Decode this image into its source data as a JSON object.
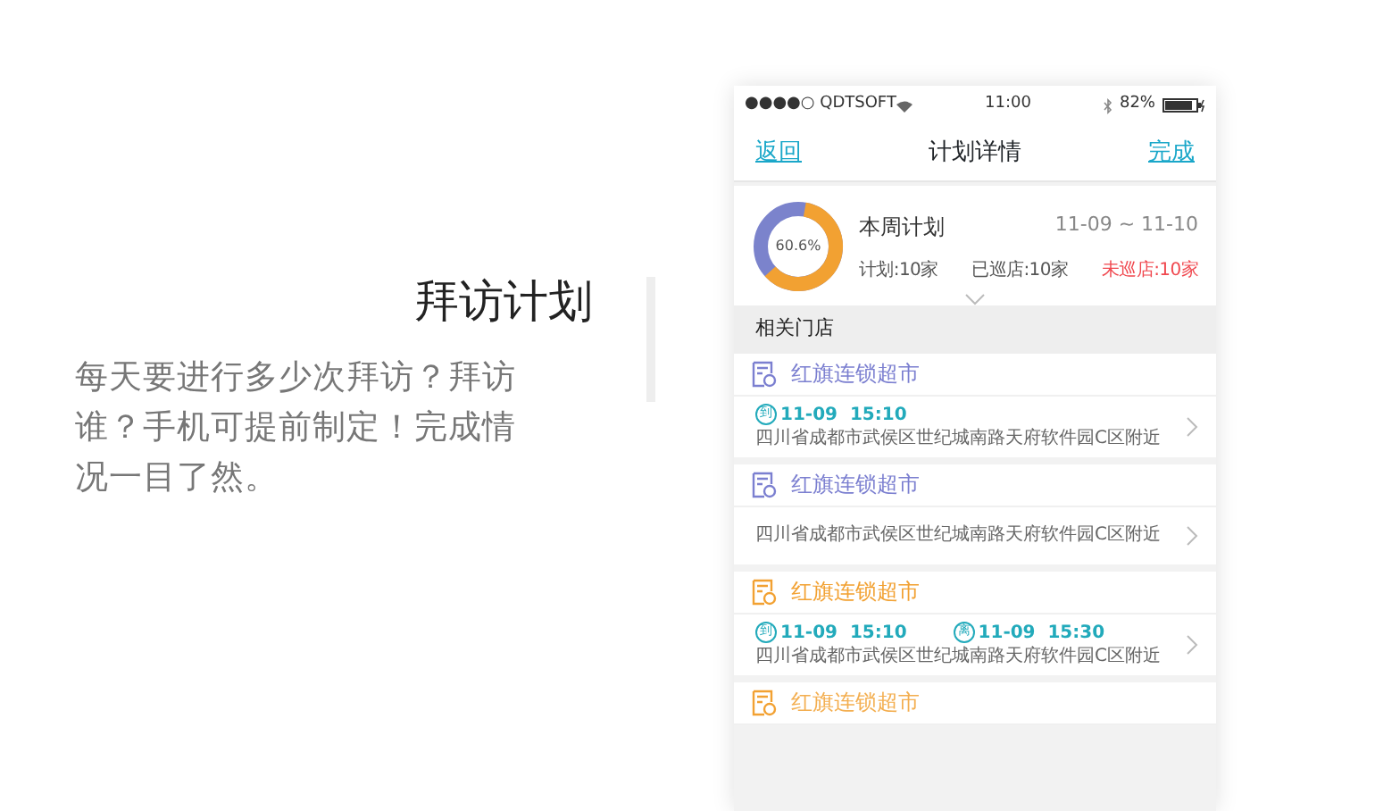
{
  "feature": {
    "title": "拜访计划",
    "description": "每天要进行多少次拜访？拜访谁？手机可提前制定！完成情况一目了然。"
  },
  "phone": {
    "status_bar": {
      "carrier": "●●●●○ QDTSOFT",
      "time": "11:00",
      "battery": "82%"
    },
    "nav": {
      "back": "返回",
      "title": "计划详情",
      "done": "完成"
    },
    "summary": {
      "percent": "60.6%",
      "level": 0.606,
      "title": "本周计划",
      "range": "11-09 ~ 11-10",
      "stats": [
        {
          "label": "计划:",
          "value": "10家",
          "kind": "normal"
        },
        {
          "label": "已巡店:",
          "value": "10家",
          "kind": "normal"
        },
        {
          "label": "未巡店:",
          "value": "10家",
          "kind": "alert"
        }
      ]
    },
    "section": "相关门店",
    "stores": [
      {
        "name": "红旗连锁超市",
        "color": "#7b7fd0",
        "faded": false,
        "times": [
          {
            "badge": "到",
            "time": "11-09  15:10"
          }
        ],
        "address": "四川省成都市武侯区世纪城南路天府软件园C区附近"
      },
      {
        "name": "红旗连锁超市",
        "color": "#7b7fd0",
        "faded": false,
        "address": "四川省成都市武侯区世纪城南路天府软件园C区附近"
      },
      {
        "name": "红旗连锁超市",
        "color": "#f2a132",
        "faded": false,
        "times": [
          {
            "badge": "到",
            "time": "11-09  15:10"
          },
          {
            "badge": "离",
            "time": "11-09  15:30"
          }
        ],
        "address": "四川省成都市武侯区世纪城南路天府软件园C区附近"
      },
      {
        "name": "红旗连锁超市",
        "color": "#f2a132",
        "faded": true
      }
    ]
  }
}
